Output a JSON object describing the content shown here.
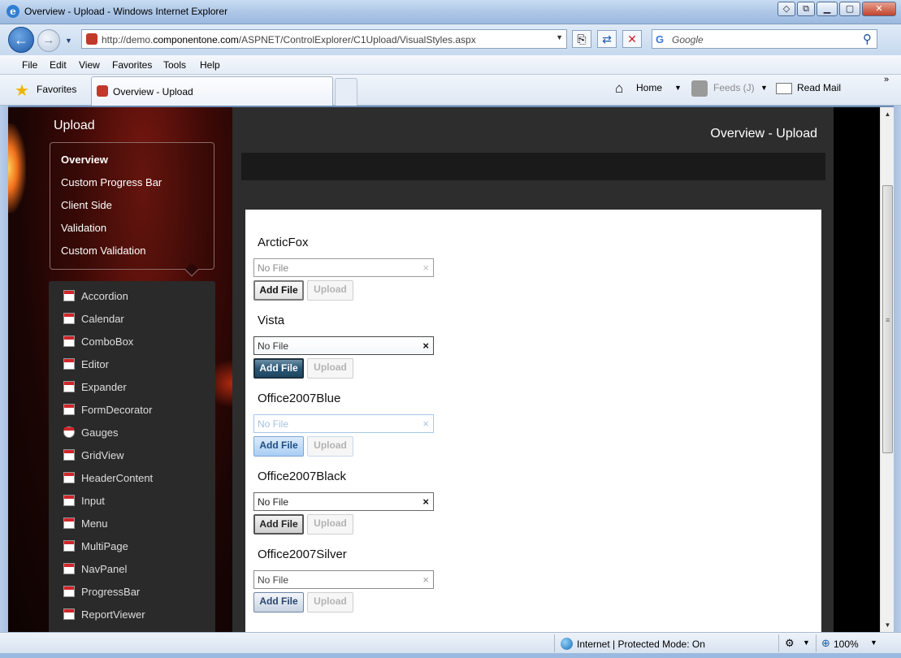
{
  "window": {
    "title": "Overview - Upload - Windows Internet Explorer"
  },
  "address": {
    "url_prefix": "http://demo.",
    "url_domain": "componentone.com",
    "url_path": "/ASPNET/ControlExplorer/C1Upload/VisualStyles.aspx"
  },
  "search": {
    "provider": "G",
    "placeholder": "Google"
  },
  "menu": {
    "file": "File",
    "edit": "Edit",
    "view": "View",
    "favorites": "Favorites",
    "tools": "Tools",
    "help": "Help"
  },
  "favbar": {
    "favorites": "Favorites",
    "tab_title": "Overview - Upload",
    "home": "Home",
    "feeds": "Feeds (J)",
    "read_mail": "Read Mail"
  },
  "sidebar": {
    "title": "Upload",
    "subnav": [
      "Overview",
      "Custom Progress Bar",
      "Client Side",
      "Validation",
      "Custom Validation"
    ],
    "controls": [
      "Accordion",
      "Calendar",
      "ComboBox",
      "Editor",
      "Expander",
      "FormDecorator",
      "Gauges",
      "GridView",
      "HeaderContent",
      "Input",
      "Menu",
      "MultiPage",
      "NavPanel",
      "ProgressBar",
      "ReportViewer"
    ]
  },
  "main": {
    "heading": "Overview - Upload",
    "groups": [
      {
        "name": "ArcticFox",
        "placeholder": "No File",
        "add": "Add File",
        "upload": "Upload"
      },
      {
        "name": "Vista",
        "placeholder": "No File",
        "add": "Add File",
        "upload": "Upload"
      },
      {
        "name": "Office2007Blue",
        "placeholder": "No File",
        "add": "Add File",
        "upload": "Upload"
      },
      {
        "name": "Office2007Black",
        "placeholder": "No File",
        "add": "Add File",
        "upload": "Upload"
      },
      {
        "name": "Office2007Silver",
        "placeholder": "No File",
        "add": "Add File",
        "upload": "Upload"
      }
    ]
  },
  "status": {
    "zone": "Internet | Protected Mode: On",
    "zoom": "100%"
  },
  "icons": {
    "clear": "×",
    "search": "⚲"
  }
}
